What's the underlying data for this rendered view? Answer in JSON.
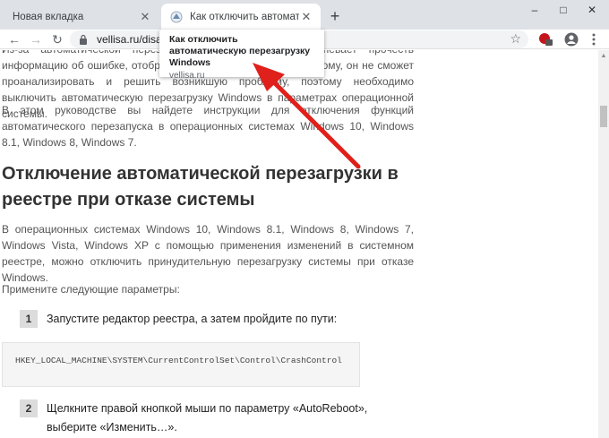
{
  "tabs": [
    {
      "label": "Новая вкладка",
      "active": false
    },
    {
      "label": "Как отключить автоматическую перезагрузку Windows",
      "active": true
    }
  ],
  "new_tab_symbol": "+",
  "window_controls": {
    "minimize": "–",
    "maximize": "□",
    "close": "✕"
  },
  "toolbar": {
    "url": "vellisa.ru/disable-automatic-restart-windows",
    "back_symbol": "←",
    "forward_symbol": "→",
    "reload_symbol": "↻",
    "star_symbol": "☆"
  },
  "tooltip": {
    "title": "Как отключить автоматическую перезагрузку Windows",
    "domain": "vellisa.ru"
  },
  "article": {
    "intro": "Из-за автоматической перезагрузки пользователь не успевает прочесть информацию об ошибке, отображаемую на синем экране, поэтому, он не сможет проанализировать и решить возникшую проблему, поэтому необходимо выключить автоматическую перезагрузку Windows в параметрах операционной системы.",
    "guide": "В этом руководстве вы найдете инструкции для отключения функций автоматического перезапуска в операционных системах Windows 10, Windows 8.1, Windows 8, Windows 7.",
    "heading": "Отключение автоматической перезагрузки в реестре при отказе системы",
    "body": "В операционных системах Windows 10, Windows 8.1, Windows 8, Windows 7, Windows Vista, Windows XP с помощью применения изменений в системном реестре, можно отключить принудительную перезагрузку системы при отказе Windows.",
    "apply": "Примените следующие параметры:",
    "steps": [
      {
        "num": "1",
        "text": "Запустите редактор реестра, а затем пройдите по пути:"
      },
      {
        "num": "2",
        "text": "Щелкните правой кнопкой мыши по параметру «AutoReboot», выберите «Изменить…»."
      }
    ],
    "code": "HKEY_LOCAL_MACHINE\\SYSTEM\\CurrentControlSet\\Control\\CrashControl"
  },
  "colors": {
    "arrow": "#e0201b",
    "tabstrip": "#dee1e6",
    "step_badge": "#dcdcdc"
  }
}
